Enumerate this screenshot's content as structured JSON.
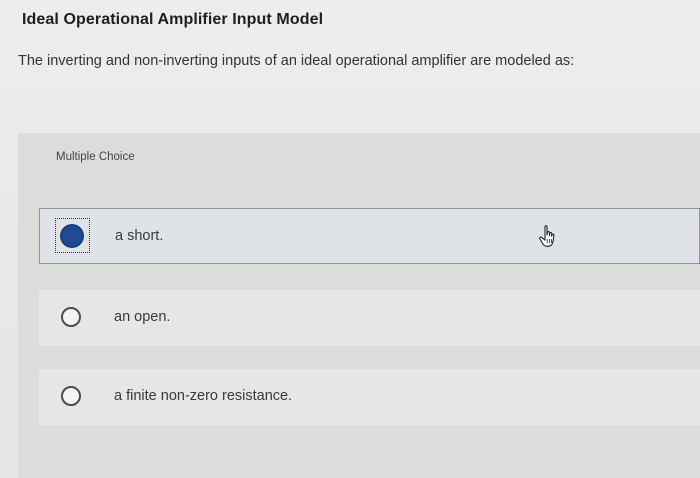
{
  "header": {
    "title": "Ideal Operational Amplifier Input Model"
  },
  "question": {
    "text": "The inverting and non-inverting inputs of an ideal operational amplifier are modeled as:"
  },
  "multiple_choice": {
    "label": "Multiple Choice",
    "options": [
      {
        "label": "a short.",
        "selected": true
      },
      {
        "label": "an open.",
        "selected": false
      },
      {
        "label": "a finite non-zero resistance.",
        "selected": false
      }
    ]
  },
  "colors": {
    "selected_radio": "#1f4b94",
    "selected_border": "#8d96a3",
    "panel_background": "#dcdcda"
  },
  "icons": {
    "cursor": "hand-pointer-icon"
  }
}
